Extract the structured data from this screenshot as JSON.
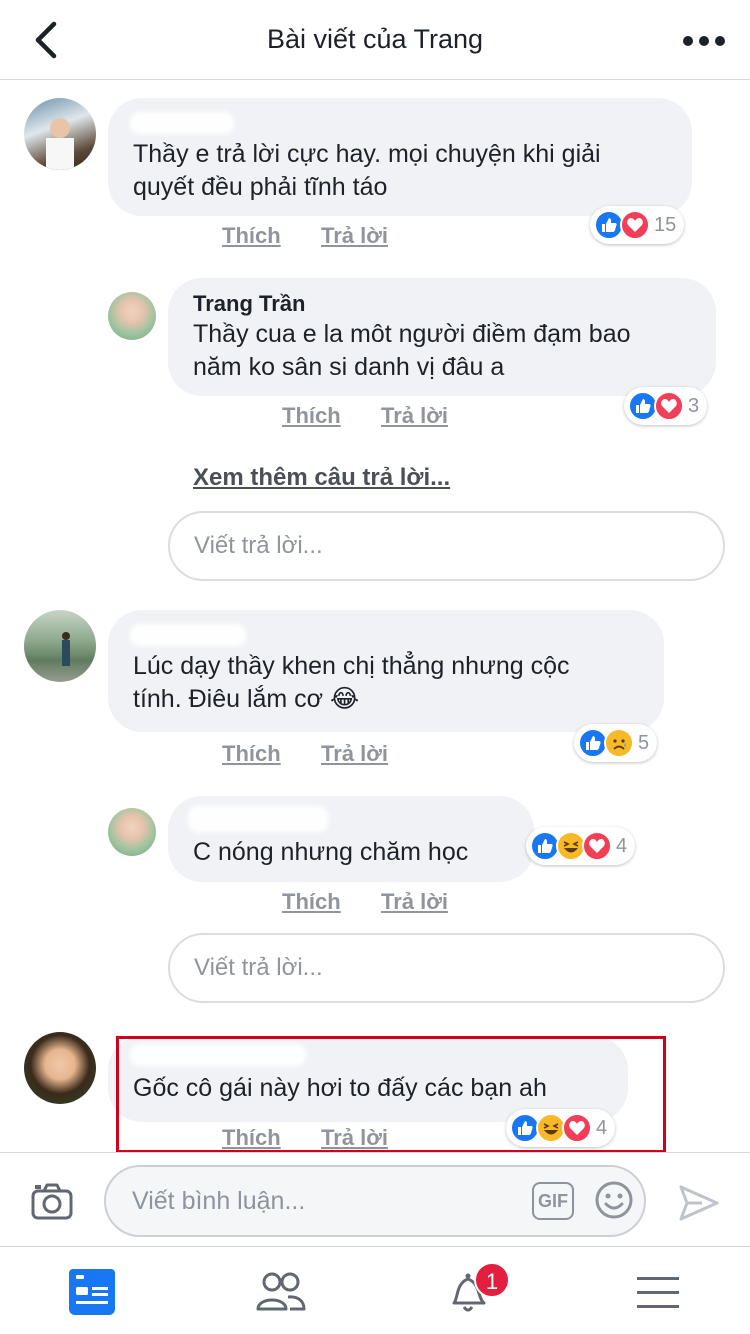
{
  "header": {
    "title": "Bài viết của Trang"
  },
  "comments": [
    {
      "text": "Thầy e trả lời cực hay. mọi chuyện khi giải\nquyết đều phải tĩnh táo",
      "like": "Thích",
      "reply": "Trả lời",
      "reaction_count": "15"
    },
    {
      "name": "Trang Trần",
      "text": "Thầy cua e la môt người điềm đạm bao\nnăm ko sân si danh vị đâu a",
      "like": "Thích",
      "reply": "Trả lời",
      "reaction_count": "3"
    },
    {
      "text": "Lúc dạy thầy khen chị thẳng nhưng cộc\ntính. Điêu lắm cơ 😂",
      "like": "Thích",
      "reply": "Trả lời",
      "reaction_count": "5"
    },
    {
      "text": "C nóng nhưng chăm học",
      "like": "Thích",
      "reply": "Trả lời",
      "reaction_count": "4"
    },
    {
      "text": "Gốc cô gái này hơi to đấy các bạn ah",
      "like": "Thích",
      "reply": "Trả lời",
      "reaction_count": "4"
    }
  ],
  "see_more_replies": "Xem thêm câu trả lời...",
  "reply_placeholder": "Viết trả lời...",
  "composer": {
    "placeholder": "Viết bình luận...",
    "gif_label": "GIF"
  },
  "tabbar": {
    "notification_badge": "1"
  },
  "colors": {
    "like": "#1877f2",
    "love": "#f33e58",
    "highlight": "#d0021b"
  }
}
